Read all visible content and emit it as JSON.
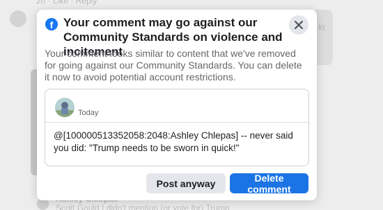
{
  "background": {
    "meta_text": "2h · Like · Reply",
    "right_text": "lo",
    "bottom_author": "Ashley Chlepas",
    "bottom_reply": "Scott Gould I didn't mention (or vote for) Trump"
  },
  "dialog": {
    "title": "Your comment may go against our Community Standards on violence and incitement",
    "description": "Your comment looks similar to content that we've removed for going against our Community Standards. You can delete it now to avoid potential account restrictions.",
    "comment": {
      "timestamp": "Today",
      "text": "@[100000513352058:2048:Ashley Chlepas] -- never said you did: \"Trump needs to be sworn in quick!\""
    },
    "buttons": {
      "post_anyway": "Post anyway",
      "delete_comment": "Delete comment"
    }
  },
  "colors": {
    "brand": "#1877f2",
    "primary_button": "#1b74e4",
    "secondary_button": "#e4e6eb"
  },
  "icons": {
    "brand": "facebook-logo-icon",
    "close": "close-icon"
  }
}
